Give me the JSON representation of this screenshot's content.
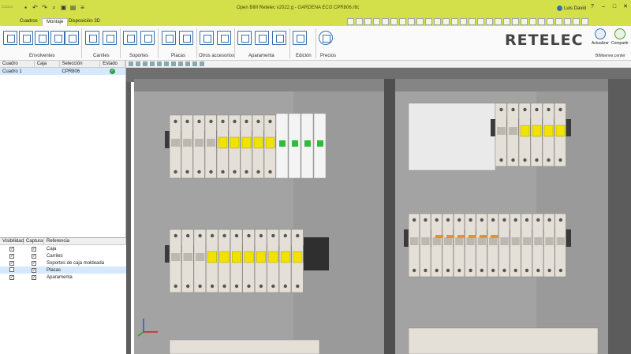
{
  "app": {
    "title": "Open BIM Retelec v2022.g - GARDENA ECO CPR806.rtlc",
    "user": "Luis David"
  },
  "tabs": [
    {
      "label": "Cuadros"
    },
    {
      "label": "Montaje"
    },
    {
      "label": "Disposición 3D"
    }
  ],
  "ribbon": {
    "groups": [
      {
        "label": "Envolventes"
      },
      {
        "label": "Carriles"
      },
      {
        "label": "Soportes"
      },
      {
        "label": "Placas"
      },
      {
        "label": "Otros accesorios"
      },
      {
        "label": "Aparamenta"
      },
      {
        "label": "Edición"
      },
      {
        "label": "Precios"
      }
    ],
    "brand": "RETELEC",
    "actualizar": "Actualizar",
    "compartir": "Compartir",
    "bimserver": "BIMserver.center"
  },
  "quadros_table": {
    "headers": [
      "Cuadro",
      "Caja",
      "Selección",
      "Estado"
    ],
    "rows": [
      {
        "cuadro": "Cuadro 1",
        "caja": "",
        "seleccion": "CPR806",
        "estado": "ok"
      }
    ]
  },
  "refs_table": {
    "headers": [
      "Visibilidad",
      "Captura",
      "Referencia"
    ],
    "rows": [
      {
        "visible": true,
        "captura": true,
        "ref": "Caja"
      },
      {
        "visible": true,
        "captura": true,
        "ref": "Carriles"
      },
      {
        "visible": true,
        "captura": true,
        "ref": "Soportes de caja moldeada"
      },
      {
        "visible": false,
        "captura": true,
        "ref": "Placas"
      },
      {
        "visible": true,
        "captura": true,
        "ref": "Aparamenta"
      }
    ]
  },
  "icons": {
    "ok": "check-circle-icon",
    "euro": "euro-icon"
  },
  "colors": {
    "accent": "#d4e04a",
    "brand_green": "#8ab800",
    "status_ok": "#2aa24a",
    "enclosure": "#9a9a9a",
    "breaker_yellow": "#f2e200"
  }
}
